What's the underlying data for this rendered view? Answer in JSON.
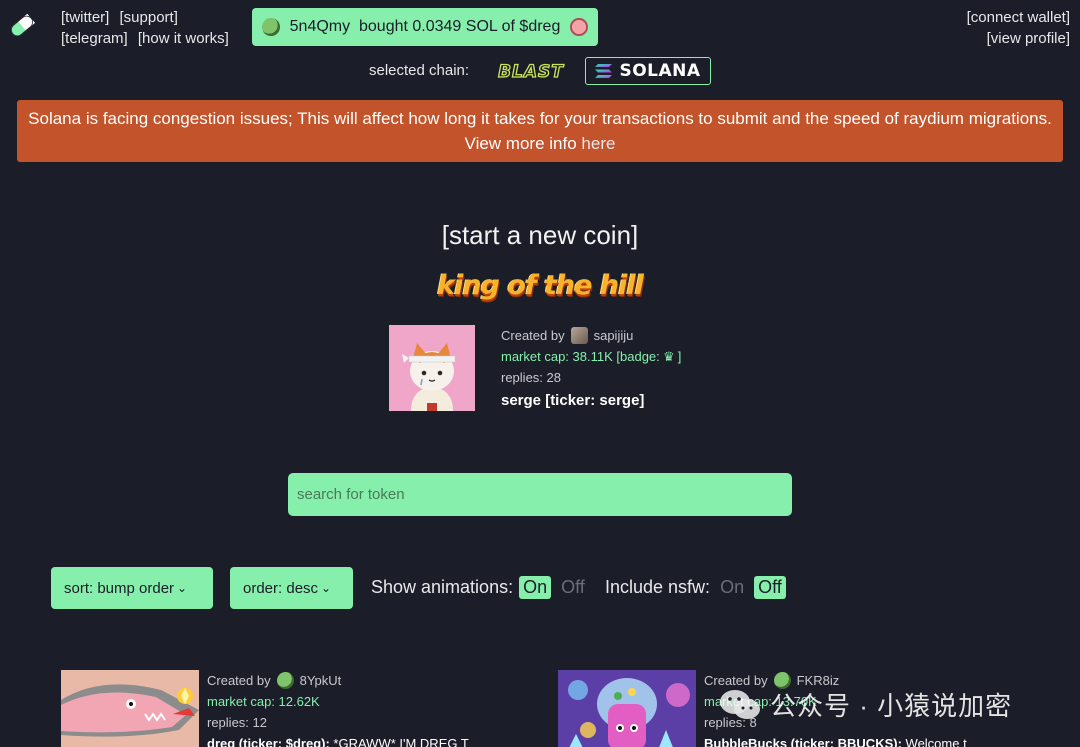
{
  "header": {
    "links_left": [
      "[twitter]",
      "[support]",
      "[telegram]",
      "[how it works]"
    ],
    "ticker": {
      "text": "5n4Qmy  bought 0.0349 SOL of $dreg"
    },
    "links_right": [
      "[connect wallet]",
      "[view profile]"
    ]
  },
  "chain": {
    "label": "selected chain:",
    "options": [
      "BLAST",
      "SOLANA"
    ],
    "selected": "SOLANA"
  },
  "alert": {
    "text": "Solana is facing congestion issues; This will affect how long it takes for your transactions to submit and the speed of raydium migrations. View more info",
    "link": "here"
  },
  "new_coin": "[start a new coin]",
  "king": {
    "banner": "king of the hill",
    "created_by_label": "Created by",
    "creator": "sapijiju",
    "market_cap": "market cap: 38.11K",
    "badge": "[badge:",
    "badge_close": "]",
    "replies": "replies: 28",
    "name": "serge [ticker: serge]"
  },
  "search": {
    "placeholder": "search for token"
  },
  "controls": {
    "sort": "sort: bump order",
    "order": "order: desc",
    "animations_label": "Show animations:",
    "nsfw_label": "Include nsfw:",
    "on": "On",
    "off": "Off",
    "animations_value": "On",
    "nsfw_value": "Off"
  },
  "coins": [
    {
      "created_by_label": "Created by",
      "creator": "8YpkUt",
      "market_cap": "market cap: 12.62K",
      "replies": "replies: 12",
      "name": "dreg (ticker: $dreg):",
      "desc": " *GRAWW* I'M DREG T"
    },
    {
      "created_by_label": "Created by",
      "creator": "FKR8iz",
      "market_cap": "market cap: 13.70K",
      "replies": "replies: 8",
      "name": "BubbleBucks (ticker: BBUCKS):",
      "desc": " Welcome t"
    }
  ],
  "watermark": "公众号 · 小猿说加密",
  "colors": {
    "bg": "#1b1d28",
    "accent": "#86efac",
    "alert": "#c2532a",
    "gold": "#f7b32b"
  }
}
